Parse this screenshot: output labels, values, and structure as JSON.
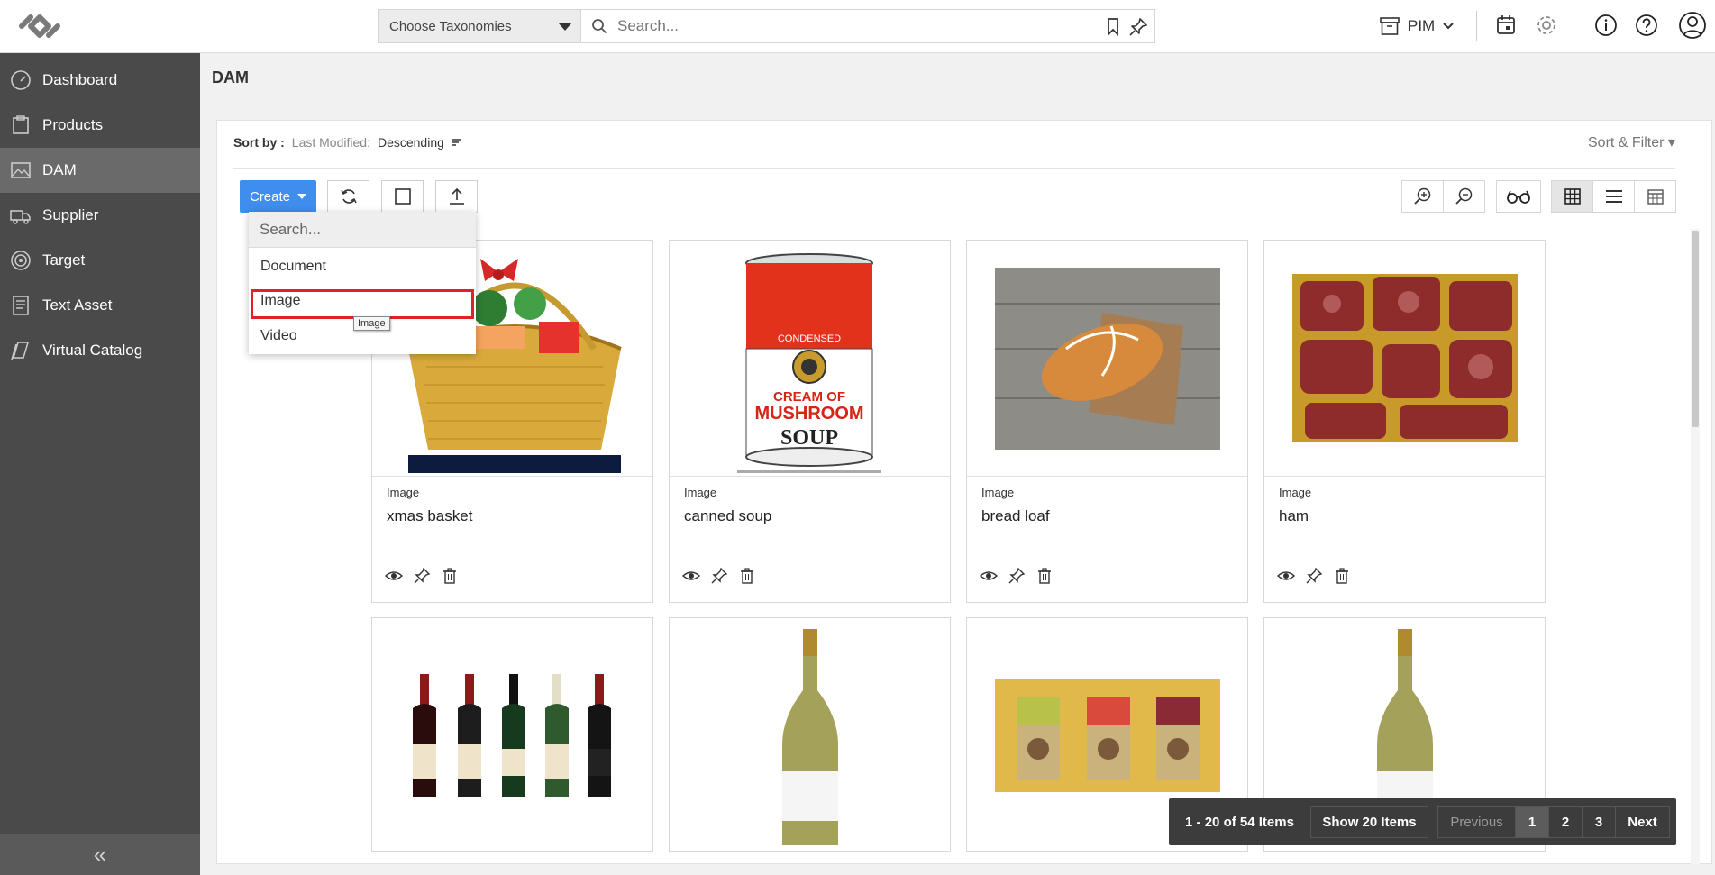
{
  "header": {
    "taxonomy_select": "Choose Taxonomies",
    "search_placeholder": "Search...",
    "module_switch": "PIM"
  },
  "sidebar": {
    "items": [
      {
        "label": "Dashboard",
        "icon": "speedometer-icon"
      },
      {
        "label": "Products",
        "icon": "product-box-icon"
      },
      {
        "label": "DAM",
        "icon": "image-icon"
      },
      {
        "label": "Supplier",
        "icon": "truck-icon"
      },
      {
        "label": "Target",
        "icon": "target-icon"
      },
      {
        "label": "Text Asset",
        "icon": "text-doc-icon"
      },
      {
        "label": "Virtual Catalog",
        "icon": "catalog-icon"
      }
    ],
    "active_item": "DAM"
  },
  "page": {
    "title": "DAM",
    "sort_label": "Sort by :",
    "sort_field": "Last Modified:",
    "sort_order": "Descending",
    "sort_filter": "Sort & Filter ▾"
  },
  "toolbar": {
    "create_label": "Create"
  },
  "create_menu": {
    "search_placeholder": "Search...",
    "items": [
      "Document",
      "Image",
      "Video"
    ],
    "highlighted": "Image",
    "tooltip": "Image"
  },
  "assets": [
    {
      "type": "Image",
      "name": "xmas basket"
    },
    {
      "type": "Image",
      "name": "canned soup"
    },
    {
      "type": "Image",
      "name": "bread loaf"
    },
    {
      "type": "Image",
      "name": "ham"
    },
    {
      "type": "",
      "name": ""
    },
    {
      "type": "",
      "name": ""
    },
    {
      "type": "",
      "name": ""
    },
    {
      "type": "",
      "name": ""
    }
  ],
  "soup_can": {
    "line1": "CONDENSED",
    "line2": "CREAM OF",
    "line3": "MUSHROOM",
    "line4": "SOUP"
  },
  "pagination": {
    "range": "1 - 20 of 54 Items",
    "page_size": "Show 20 Items",
    "previous": "Previous",
    "pages": [
      "1",
      "2",
      "3"
    ],
    "current": "1",
    "next": "Next"
  },
  "colors": {
    "accent": "#3f8ded",
    "sidebar": "#4a4a4a",
    "highlight_border": "#e0202a"
  }
}
